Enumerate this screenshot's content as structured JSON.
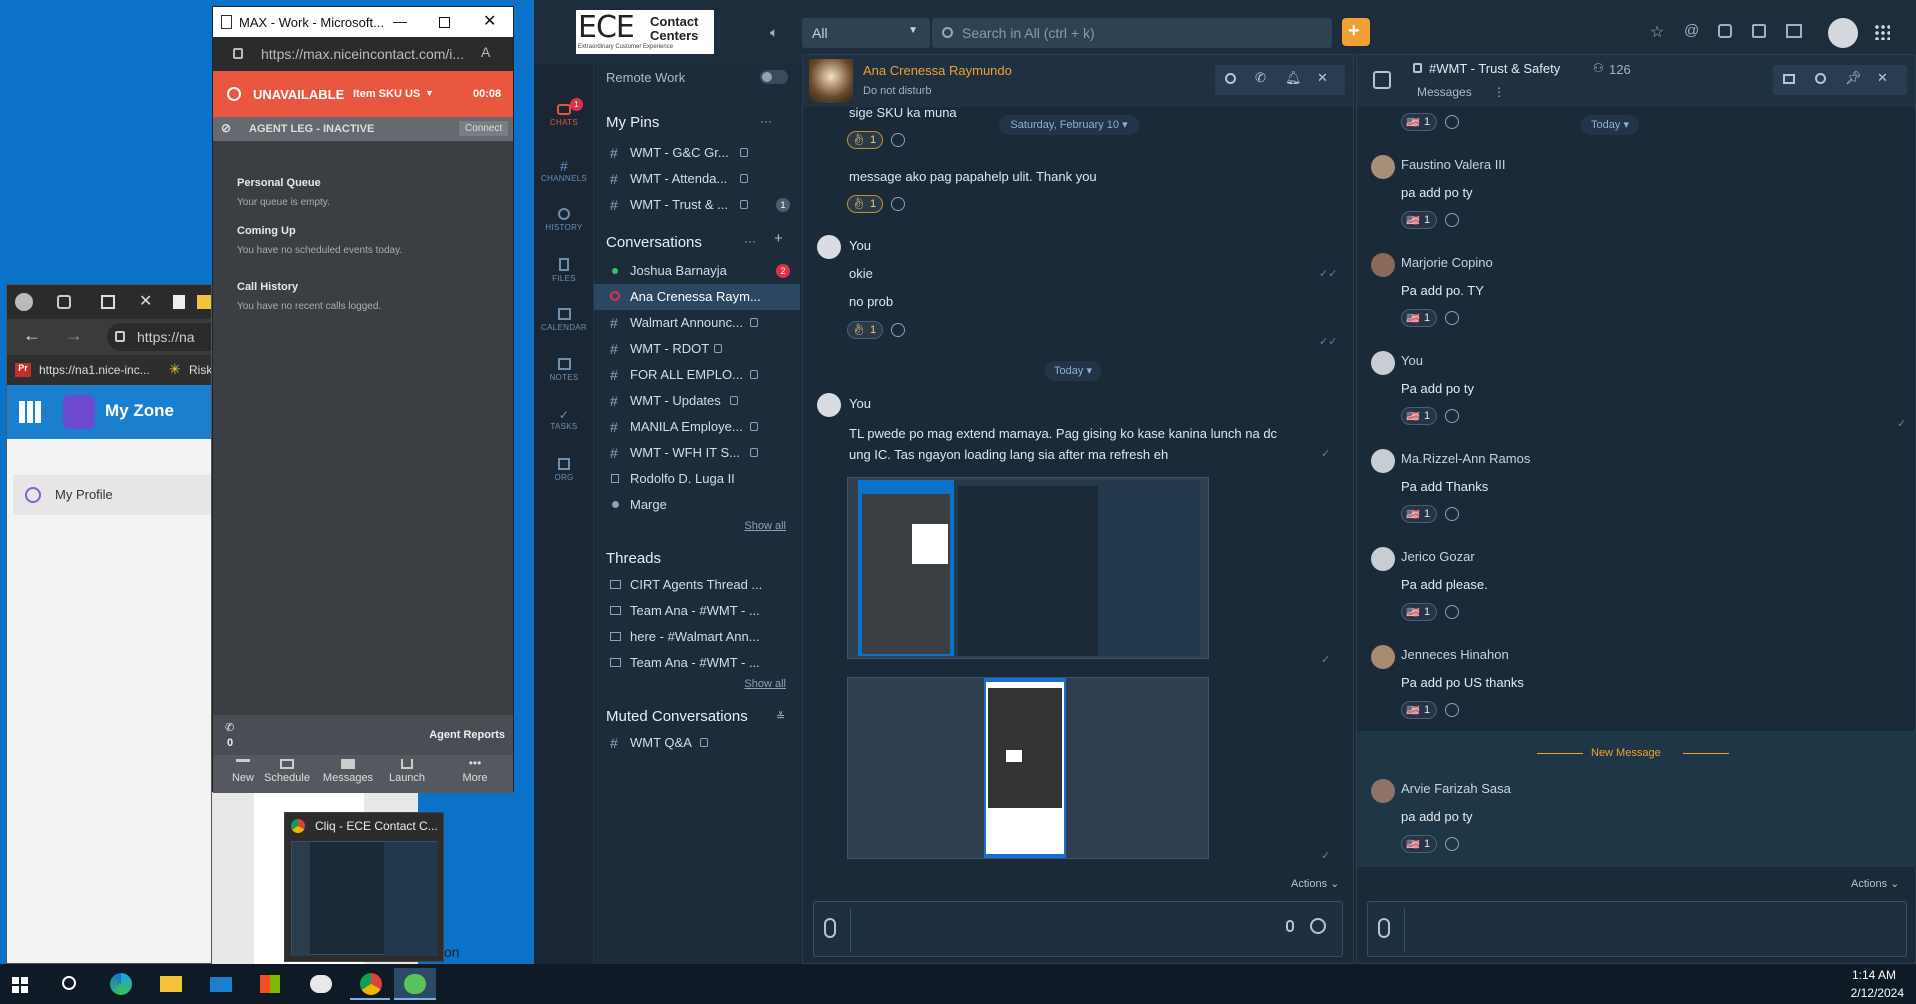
{
  "max_window": {
    "title": "MAX - Work - Microsoft...",
    "url": "https://max.niceincontact.com/i...",
    "status": "UNAVAILABLE",
    "status_sub": "Item SKU US",
    "timer": "00:08",
    "agent_leg": "AGENT LEG - INACTIVE",
    "connect": "Connect",
    "personal_queue_title": "Personal Queue",
    "personal_queue_text": "Your queue is empty.",
    "coming_up_title": "Coming Up",
    "coming_up_text": "You have no scheduled events today.",
    "call_history_title": "Call History",
    "call_history_text": "You have no recent calls logged.",
    "calls_count": "0",
    "agent_reports": "Agent Reports",
    "bottom_buttons": [
      "New",
      "Schedule",
      "Messages",
      "Launch",
      "More"
    ]
  },
  "edge_window": {
    "url": "https://na",
    "fav1": "https://na1.nice-inc...",
    "fav2": "Risk",
    "app_title": "My Zone",
    "profile": "My Profile",
    "trailing_text": "on"
  },
  "taskbar_thumb": {
    "title": "Cliq - ECE Contact C..."
  },
  "cliq": {
    "logo_big": "ECE",
    "logo_line1": "Contact",
    "logo_line2": "Centers",
    "logo_tag": "Extraordinary Customer Experience",
    "scope": "All",
    "search_placeholder": "Search in All (ctrl + k)",
    "rail": [
      {
        "label": "CHATS",
        "badge": "1"
      },
      {
        "label": "CHANNELS"
      },
      {
        "label": "HISTORY"
      },
      {
        "label": "FILES"
      },
      {
        "label": "CALENDAR"
      },
      {
        "label": "NOTES"
      },
      {
        "label": "TASKS"
      },
      {
        "label": "ORG"
      }
    ],
    "remote_work": "Remote Work",
    "pins_title": "My Pins",
    "pins": [
      {
        "label": "WMT - G&C Gr..."
      },
      {
        "label": "WMT - Attenda..."
      },
      {
        "label": "WMT - Trust & ...",
        "badge": "1"
      }
    ],
    "conversations_title": "Conversations",
    "conversations": [
      {
        "label": "Joshua Barnayja",
        "badge": "2"
      },
      {
        "label": "Ana Crenessa Raym..."
      },
      {
        "label": "Walmart Announc..."
      },
      {
        "label": "WMT - RDOT"
      },
      {
        "label": "FOR ALL EMPLO..."
      },
      {
        "label": "WMT - Updates"
      },
      {
        "label": "MANILA Employe..."
      },
      {
        "label": "WMT - WFH IT S..."
      },
      {
        "label": "Rodolfo D. Luga II"
      },
      {
        "label": "Marge"
      }
    ],
    "show_all": "Show all",
    "threads_title": "Threads",
    "threads": [
      {
        "label": "CIRT Agents Thread ..."
      },
      {
        "label": "Team Ana - #WMT - ..."
      },
      {
        "label": "here - #Walmart Ann..."
      },
      {
        "label": "Team Ana - #WMT - ..."
      }
    ],
    "muted_title": "Muted Conversations",
    "muted": [
      {
        "label": "WMT Q&A"
      }
    ]
  },
  "chat": {
    "name": "Ana Crenessa Raymundo",
    "presence": "Do not disturb",
    "top_text": "sige SKU ka muna",
    "date1": "Saturday, February 10",
    "msg1": "message ako pag papahelp ulit. Thank you",
    "you": "You",
    "okie": "okie",
    "noprob": "no prob",
    "date2": "Today",
    "long_msg": "TL pwede po mag extend mamaya. Pag gising ko kase kanina lunch na dc ung IC. Tas ngayon loading lang sia after ma refresh eh",
    "reaction_count": "1",
    "actions": "Actions"
  },
  "channel": {
    "name": "#WMT - Trust & Safety",
    "members": "126",
    "tab": "Messages",
    "date": "Today",
    "flag_count": "1",
    "messages": [
      {
        "sender": "Faustino Valera III",
        "text": "pa add po ty"
      },
      {
        "sender": "Marjorie Copino",
        "text": "Pa add po. TY"
      },
      {
        "sender": "You",
        "text": "Pa add po ty"
      },
      {
        "sender": "Ma.Rizzel-Ann Ramos",
        "text": "Pa add Thanks"
      },
      {
        "sender": "Jerico Gozar",
        "text": "Pa add please."
      },
      {
        "sender": "Jenneces Hinahon",
        "text": "Pa add po US thanks"
      },
      {
        "sender": "Arvie Farizah Sasa",
        "text": "pa add po ty"
      }
    ],
    "new_message": "New Message",
    "actions": "Actions"
  },
  "taskbar": {
    "time": "1:14 AM",
    "date": "2/12/2024"
  }
}
